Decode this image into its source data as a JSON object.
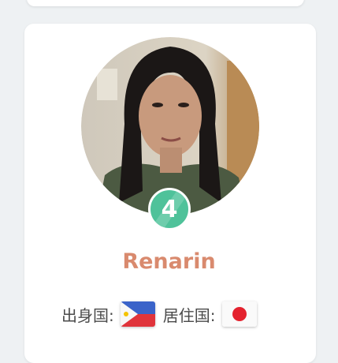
{
  "profile": {
    "name": "Renarin",
    "level": "4",
    "birth_country_label": "出身国:",
    "birth_country_flag": "philippines-flag-icon",
    "residence_country_label": "居住国:",
    "residence_country_flag": "japan-flag-icon"
  },
  "colors": {
    "name": "#d98a6e",
    "badge": "#4fc29a"
  }
}
